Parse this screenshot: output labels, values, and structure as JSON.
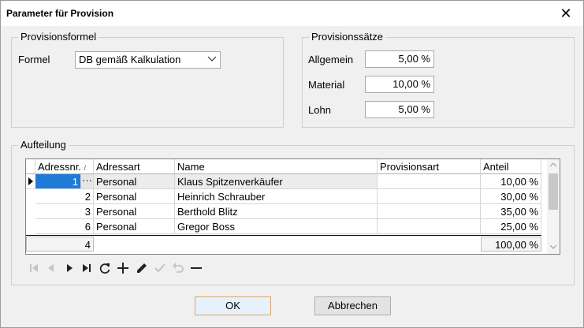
{
  "window": {
    "title": "Parameter für Provision"
  },
  "formula_group": {
    "legend": "Provisionsformel",
    "formula_label": "Formel",
    "formula_value": "DB gemäß Kalkulation"
  },
  "rates_group": {
    "legend": "Provisionssätze",
    "rows": [
      {
        "label": "Allgemein",
        "value": "5,00 %"
      },
      {
        "label": "Material",
        "value": "10,00 %"
      },
      {
        "label": "Lohn",
        "value": "5,00 %"
      }
    ]
  },
  "distribution_group": {
    "legend": "Aufteilung",
    "columns": [
      "Adressnr.",
      "Adressart",
      "Name",
      "Provisionsart",
      "Anteil"
    ],
    "sort_indicator": "/",
    "rows": [
      {
        "adressnr": "1",
        "adressart": "Personal",
        "name": "Klaus Spitzenverkäufer",
        "provisionsart": "",
        "anteil": "10,00 %"
      },
      {
        "adressnr": "2",
        "adressart": "Personal",
        "name": "Heinrich Schrauber",
        "provisionsart": "",
        "anteil": "30,00 %"
      },
      {
        "adressnr": "3",
        "adressart": "Personal",
        "name": "Berthold Blitz",
        "provisionsart": "",
        "anteil": "35,00 %"
      },
      {
        "adressnr": "6",
        "adressart": "Personal",
        "name": "Gregor Boss",
        "provisionsart": "",
        "anteil": "25,00 %"
      }
    ],
    "footer": {
      "count": "4",
      "total": "100,00 %"
    },
    "ellipsis": "···"
  },
  "buttons": {
    "ok": "OK",
    "cancel": "Abbrechen"
  },
  "icons": [
    "first-record-icon",
    "prior-record-icon",
    "next-record-icon",
    "last-record-icon",
    "refresh-icon",
    "add-icon",
    "edit-icon",
    "post-icon",
    "cancel-edit-icon",
    "delete-icon"
  ]
}
